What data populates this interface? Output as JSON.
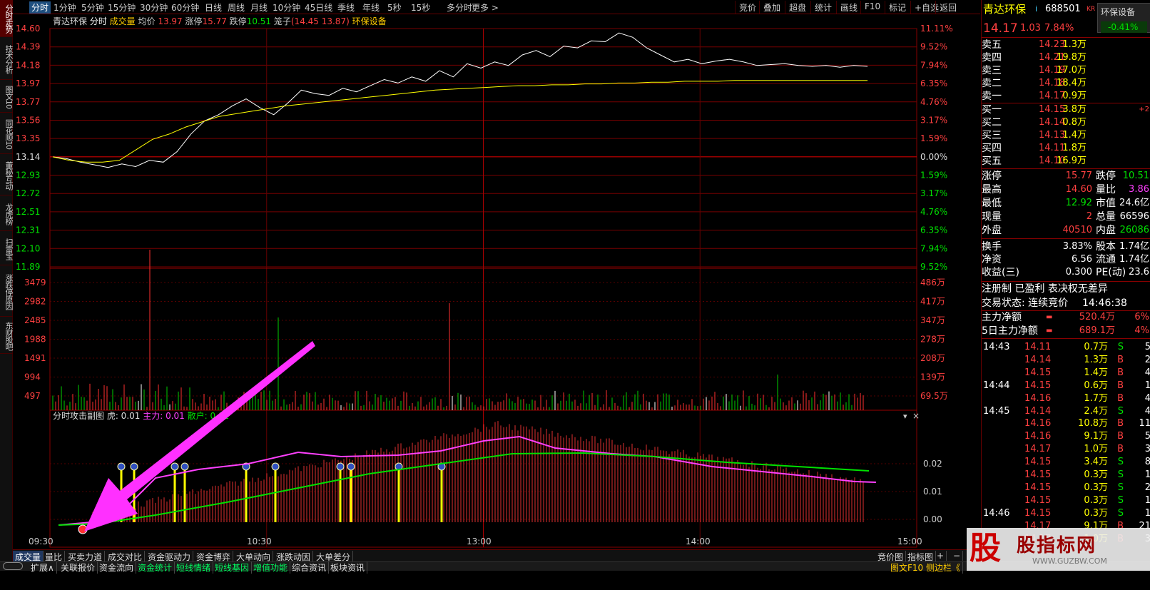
{
  "left_tabs": [
    "分时走势",
    "技术分析",
    "图文10",
    "同花顺10",
    "董秘互动",
    "龙虎榜",
    "扫雷宝",
    "涨跌停原因",
    "东财股吧"
  ],
  "periods": [
    "分时",
    "1分钟",
    "5分钟",
    "15分钟",
    "30分钟",
    "60分钟",
    "日线",
    "周线",
    "月线",
    "10分钟",
    "45日线",
    "季线",
    "年线",
    "5秒",
    "15秒",
    "多分时",
    "更多 >"
  ],
  "toolbar": [
    "竞价",
    "叠加",
    "超盘",
    "统计",
    "画线",
    "F10",
    "标记",
    "+自选",
    "返回"
  ],
  "chart_info": {
    "name": "青达环保",
    "mode": "分时",
    "vol_label": "成交量",
    "avg_label": "均价",
    "avg": "13.97",
    "zt_label": "涨停",
    "zt": "15.77",
    "dt_label": "跌停",
    "dt": "10.51",
    "lz_label": "笼子",
    "lz": "(14.45 13.87)",
    "sector": "环保设备"
  },
  "chart_data": {
    "type": "line",
    "price_axis": [
      "14.60",
      "14.39",
      "14.18",
      "13.97",
      "13.77",
      "13.56",
      "13.35",
      "13.14",
      "12.93",
      "12.72",
      "12.51",
      "12.31",
      "12.10",
      "11.89"
    ],
    "pct_axis": [
      "11.11%",
      "9.52%",
      "7.94%",
      "6.35%",
      "4.76%",
      "3.17%",
      "1.59%",
      "0.00%",
      "1.59%",
      "3.17%",
      "4.76%",
      "6.35%",
      "7.94%",
      "9.52%"
    ],
    "vol_axis": [
      "3479",
      "2982",
      "2485",
      "1988",
      "1491",
      "994",
      "497"
    ],
    "vol_axis_right": [
      "486万",
      "417万",
      "347万",
      "278万",
      "208万",
      "139万",
      "69.5万"
    ],
    "sub_axis": [
      "0.02",
      "0.01",
      "0.00"
    ],
    "time_axis": [
      "09:30",
      "10:30",
      "13:00",
      "14:00",
      "15:00"
    ],
    "price_series": [
      13.14,
      13.12,
      13.08,
      13.05,
      13.02,
      13.06,
      13.03,
      13.1,
      13.08,
      13.2,
      13.4,
      13.55,
      13.62,
      13.72,
      13.8,
      13.7,
      13.62,
      13.75,
      13.9,
      13.86,
      13.84,
      13.92,
      13.88,
      13.95,
      14.02,
      13.98,
      14.05,
      14.0,
      14.12,
      14.05,
      14.2,
      14.15,
      14.22,
      14.18,
      14.3,
      14.35,
      14.28,
      14.4,
      14.38,
      14.46,
      14.45,
      14.55,
      14.5,
      14.38,
      14.3,
      14.22,
      14.25,
      14.2,
      14.23,
      14.25,
      14.22,
      14.18,
      14.19,
      14.2,
      14.18,
      14.17,
      14.18,
      14.16,
      14.18,
      14.17
    ],
    "avg_series": [
      13.14,
      13.1,
      13.08,
      13.08,
      13.1,
      13.22,
      13.34,
      13.4,
      13.48,
      13.54,
      13.6,
      13.63,
      13.66,
      13.69,
      13.72,
      13.74,
      13.76,
      13.78,
      13.8,
      13.82,
      13.84,
      13.86,
      13.88,
      13.9,
      13.91,
      13.92,
      13.93,
      13.94,
      13.95,
      13.95,
      13.96,
      13.96,
      13.97,
      13.97,
      13.98,
      13.98,
      13.99,
      13.99,
      14.0,
      14.0,
      14.0,
      14.01,
      14.01,
      14.01,
      14.01,
      14.01,
      14.01,
      14.01,
      14.01,
      14.01
    ]
  },
  "sub_chart": {
    "title": "分时攻击副图",
    "hu_label": "虎:",
    "hu": "0.01",
    "zl_label": "主力:",
    "zl": "0.01",
    "sh_label": "散户:",
    "sh": "0.02"
  },
  "quote": {
    "name": "青达环保",
    "code": "688501",
    "kr": "KR",
    "sector_btn": "环保设备",
    "sector_pct": "-0.41%",
    "price": "14.17",
    "change": "1.03",
    "pct": "7.84%",
    "asks": [
      {
        "l": "卖五",
        "p": "14.23",
        "v": "1.3万"
      },
      {
        "l": "卖四",
        "p": "14.21",
        "v": "19.8万"
      },
      {
        "l": "卖三",
        "p": "14.19",
        "v": "17.0万"
      },
      {
        "l": "卖二",
        "p": "14.18",
        "v": "18.4万"
      },
      {
        "l": "卖一",
        "p": "14.17",
        "v": "0.9万"
      }
    ],
    "bids": [
      {
        "l": "买一",
        "p": "14.15",
        "v": "3.8万",
        "x": "+2"
      },
      {
        "l": "买二",
        "p": "14.14",
        "v": "0.8万",
        "x": ""
      },
      {
        "l": "买三",
        "p": "14.13",
        "v": "1.4万",
        "x": ""
      },
      {
        "l": "买四",
        "p": "14.11",
        "v": "1.8万",
        "x": ""
      },
      {
        "l": "买五",
        "p": "14.10",
        "v": "16.9万",
        "x": ""
      }
    ],
    "stats": [
      {
        "l1": "涨停",
        "v1": "15.77",
        "c1": "red",
        "l2": "跌停",
        "v2": "10.51",
        "c2": "green"
      },
      {
        "l1": "最高",
        "v1": "14.60",
        "c1": "red",
        "l2": "量比",
        "v2": "3.86",
        "c2": "mag"
      },
      {
        "l1": "最低",
        "v1": "12.92",
        "c1": "green",
        "l2": "市值",
        "v2": "24.6亿",
        "c2": "white"
      },
      {
        "l1": "现量",
        "v1": "2",
        "c1": "red",
        "l2": "总量",
        "v2": "66596",
        "c2": "white"
      },
      {
        "l1": "外盘",
        "v1": "40510",
        "c1": "red",
        "l2": "内盘",
        "v2": "26086",
        "c2": "green"
      }
    ],
    "stats2": [
      {
        "l1": "换手",
        "v1": "3.83%",
        "l2": "股本",
        "v2": "1.74亿"
      },
      {
        "l1": "净资",
        "v1": "6.56",
        "l2": "流通",
        "v2": "1.74亿"
      },
      {
        "l1": "收益(三)",
        "v1": "0.300",
        "l2": "PE(动)",
        "v2": "23.6"
      }
    ],
    "tags": "注册制 已盈利 表决权无差异",
    "trade_state_label": "交易状态: 连续竞价",
    "trade_time": "14:46:38",
    "main_net_label": "主力净额",
    "main_net": "520.4万",
    "main_net_pct": "6%",
    "main5_label": "5日主力净额",
    "main5": "689.1万",
    "main5_pct": "4%",
    "ticks": [
      {
        "t": "14:43",
        "p": "14.11",
        "v": "0.7万",
        "s": "S",
        "n": "5"
      },
      {
        "t": "",
        "p": "14.14",
        "v": "1.3万",
        "s": "B",
        "n": "2"
      },
      {
        "t": "",
        "p": "14.15",
        "v": "1.4万",
        "s": "B",
        "n": "4"
      },
      {
        "t": "14:44",
        "p": "14.15",
        "v": "0.6万",
        "s": "B",
        "n": "1"
      },
      {
        "t": "",
        "p": "14.16",
        "v": "1.7万",
        "s": "B",
        "n": "4"
      },
      {
        "t": "14:45",
        "p": "14.14",
        "v": "2.4万",
        "s": "S",
        "n": "4"
      },
      {
        "t": "",
        "p": "14.16",
        "v": "10.8万",
        "s": "B",
        "n": "11"
      },
      {
        "t": "",
        "p": "14.16",
        "v": "9.1万",
        "s": "B",
        "n": "5"
      },
      {
        "t": "",
        "p": "14.17",
        "v": "1.0万",
        "s": "B",
        "n": "3"
      },
      {
        "t": "",
        "p": "14.15",
        "v": "3.4万",
        "s": "S",
        "n": "8"
      },
      {
        "t": "",
        "p": "14.15",
        "v": "0.3万",
        "s": "S",
        "n": "1"
      },
      {
        "t": "",
        "p": "14.15",
        "v": "0.3万",
        "s": "S",
        "n": "2"
      },
      {
        "t": "",
        "p": "14.15",
        "v": "0.3万",
        "s": "S",
        "n": "1"
      },
      {
        "t": "14:46",
        "p": "14.15",
        "v": "0.3万",
        "s": "S",
        "n": "1"
      },
      {
        "t": "",
        "p": "14.17",
        "v": "9.1万",
        "s": "B",
        "n": "21"
      },
      {
        "t": "",
        "p": "14.17",
        "v": "1.0万",
        "s": "B",
        "n": "3"
      }
    ]
  },
  "bottom_tabs": [
    "成交量",
    "量比",
    "买卖力道",
    "成交对比",
    "资金驱动力",
    "资金博弈",
    "大单动向",
    "涨跌动因",
    "大单差分"
  ],
  "bottom_right": [
    "竞价图",
    "指标图",
    "+",
    "−"
  ],
  "status": [
    "扩展∧",
    "关联报价",
    "资金流向",
    "资金统计",
    "短线情绪",
    "短线基因",
    "增值功能",
    "综合资讯",
    "板块资讯"
  ],
  "status_right": "图文F10 侧边栏《",
  "watermark": {
    "text": "股指标网",
    "url": "WWW.GUZBW.COM"
  }
}
